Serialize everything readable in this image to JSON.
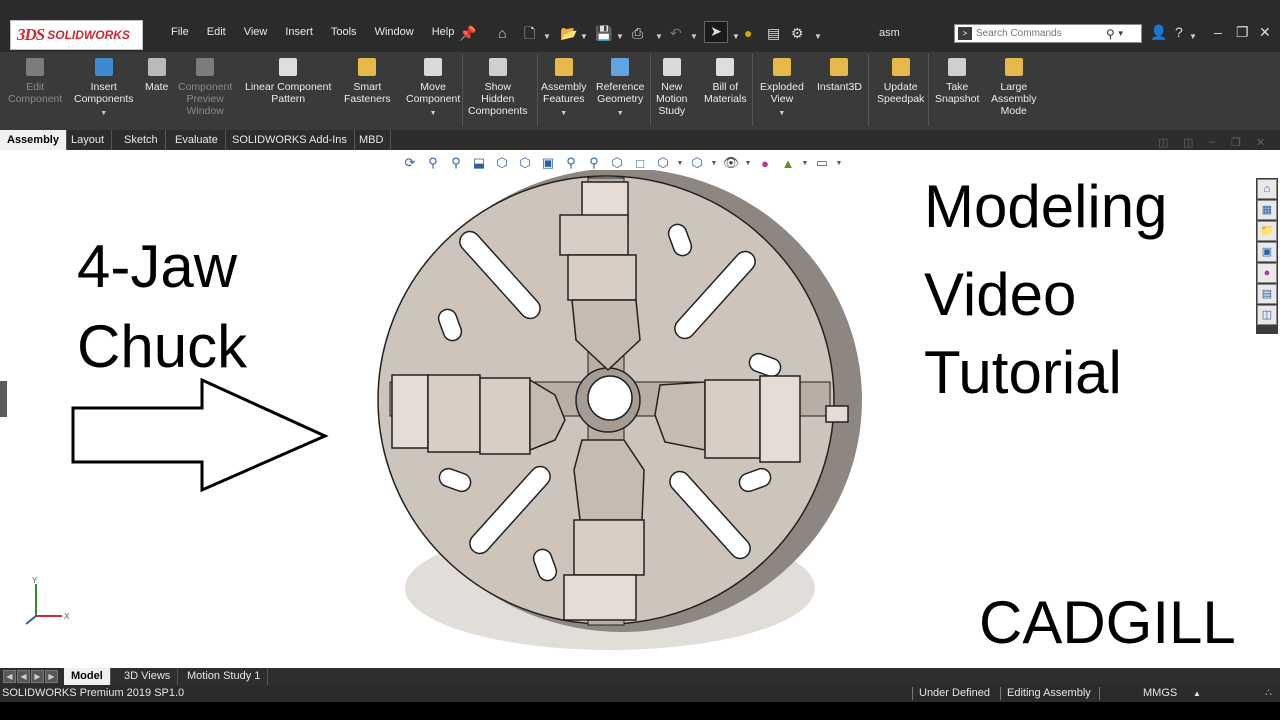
{
  "app": {
    "brand_mark": "3DS",
    "brand_name": "SOLIDWORKS",
    "document_name": "asm"
  },
  "menu": [
    "File",
    "Edit",
    "View",
    "Insert",
    "Tools",
    "Window",
    "Help"
  ],
  "search": {
    "placeholder": "Search Commands"
  },
  "command_manager": {
    "tools": [
      {
        "label": "Edit\nComponent",
        "icon": "edit-component-icon",
        "enabled": false
      },
      {
        "label": "Insert\nComponents",
        "icon": "insert-components-icon",
        "enabled": true,
        "dropdown": true
      },
      {
        "label": "Mate",
        "icon": "mate-icon",
        "enabled": true
      },
      {
        "label": "Component\nPreview\nWindow",
        "icon": "component-preview-icon",
        "enabled": false
      },
      {
        "label": "Linear Component\nPattern",
        "icon": "linear-pattern-icon",
        "enabled": true
      },
      {
        "label": "Smart\nFasteners",
        "icon": "smart-fasteners-icon",
        "enabled": true
      },
      {
        "label": "Move\nComponent",
        "icon": "move-component-icon",
        "enabled": true,
        "dropdown": true
      },
      {
        "label": "Show\nHidden\nComponents",
        "icon": "show-hidden-icon",
        "enabled": true
      },
      {
        "label": "Assembly\nFeatures",
        "icon": "assembly-features-icon",
        "enabled": true,
        "dropdown": true
      },
      {
        "label": "Reference\nGeometry",
        "icon": "reference-geometry-icon",
        "enabled": true,
        "dropdown": true
      },
      {
        "label": "New\nMotion\nStudy",
        "icon": "motion-study-icon",
        "enabled": true
      },
      {
        "label": "Bill of\nMaterials",
        "icon": "bill-of-materials-icon",
        "enabled": true
      },
      {
        "label": "Exploded\nView",
        "icon": "exploded-view-icon",
        "enabled": true,
        "dropdown": true
      },
      {
        "label": "Instant3D",
        "icon": "instant3d-icon",
        "enabled": true
      },
      {
        "label": "Update\nSpeedpak",
        "icon": "speedpak-icon",
        "enabled": true
      },
      {
        "label": "Take\nSnapshot",
        "icon": "snapshot-icon",
        "enabled": true
      },
      {
        "label": "Large\nAssembly\nMode",
        "icon": "large-assembly-icon",
        "enabled": true
      }
    ]
  },
  "tabs": [
    "Assembly",
    "Layout",
    "Sketch",
    "Evaluate",
    "SOLIDWORKS Add-Ins",
    "MBD"
  ],
  "active_tab": "Assembly",
  "overlay": {
    "left_line1": "4-Jaw",
    "left_line2": "Chuck",
    "right_line1": "Modeling",
    "right_line2": "Video",
    "right_line3": "Tutorial",
    "brand": "CADGILL"
  },
  "triad": {
    "y": "Y",
    "x": "X"
  },
  "document_tabs": [
    "Model",
    "3D Views",
    "Motion Study 1"
  ],
  "active_document_tab": "Model",
  "status": {
    "product": "SOLIDWORKS Premium 2019 SP1.0",
    "definition": "Under Defined",
    "mode": "Editing Assembly",
    "units": "MMGS"
  },
  "colors": {
    "ui_dark": "#2b2b2b",
    "command_bar": "#3a3a3a",
    "brand_red": "#d22630",
    "model_metal": "#c9bfb6",
    "model_shadow": "#9a8f86"
  }
}
